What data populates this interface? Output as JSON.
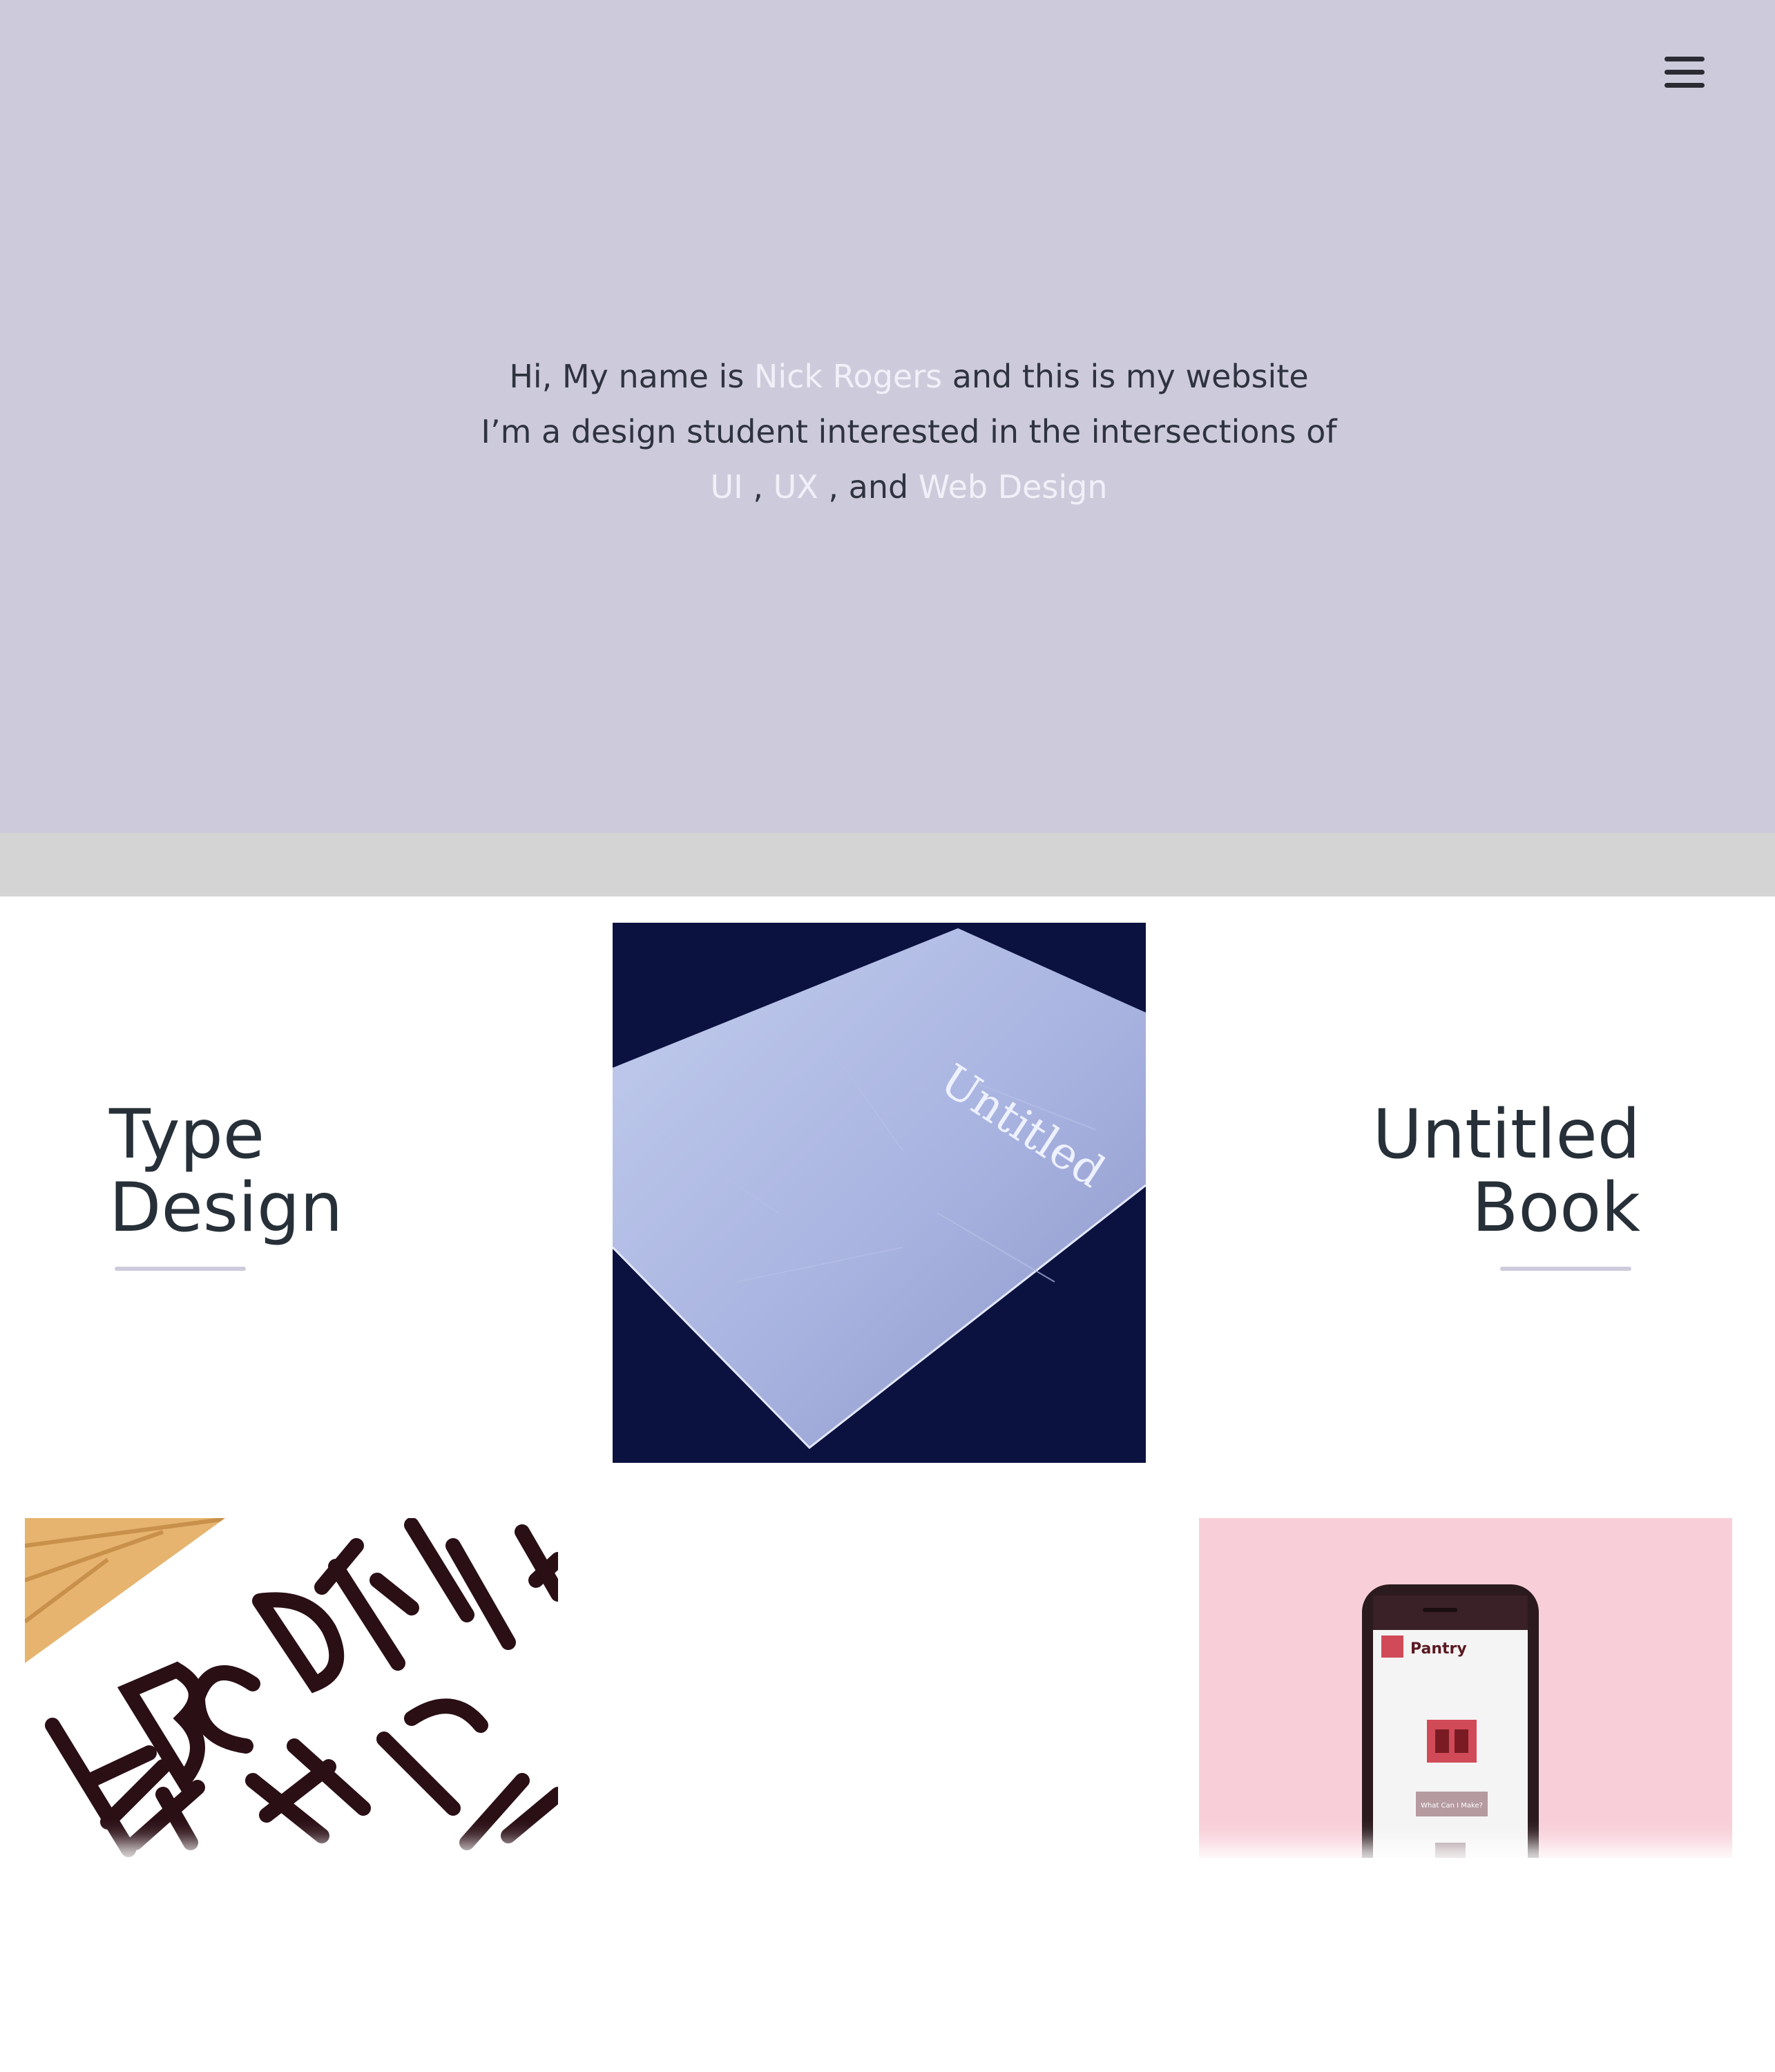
{
  "header": {
    "menu_icon": "hamburger-menu-icon"
  },
  "intro": {
    "line1_pre": "Hi, My name is ",
    "name": "Nick Rogers",
    "line1_post": " and this is my website",
    "line2": "I’m a design student interested in the intersections of",
    "skill1": "UI",
    "sep1": " , ",
    "skill2": "UX",
    "sep2": " , and ",
    "skill3": "Web Design"
  },
  "projects": {
    "type_design": {
      "title_line1": "Type",
      "title_line2": "Design"
    },
    "untitled_book": {
      "title_line1": "Untitled",
      "title_line2": "Book",
      "cover_text": "Untitled"
    },
    "pantry_app": {
      "app_name": "Pantry",
      "button_label": "What Can I Make?"
    }
  },
  "colors": {
    "hero_bg": "#cdcbdb",
    "highlight_text": "#f1f0f8",
    "body_text": "#2f3340",
    "title_text": "#273038",
    "underline": "#cdcbdb",
    "band": "#d4d4d4"
  }
}
